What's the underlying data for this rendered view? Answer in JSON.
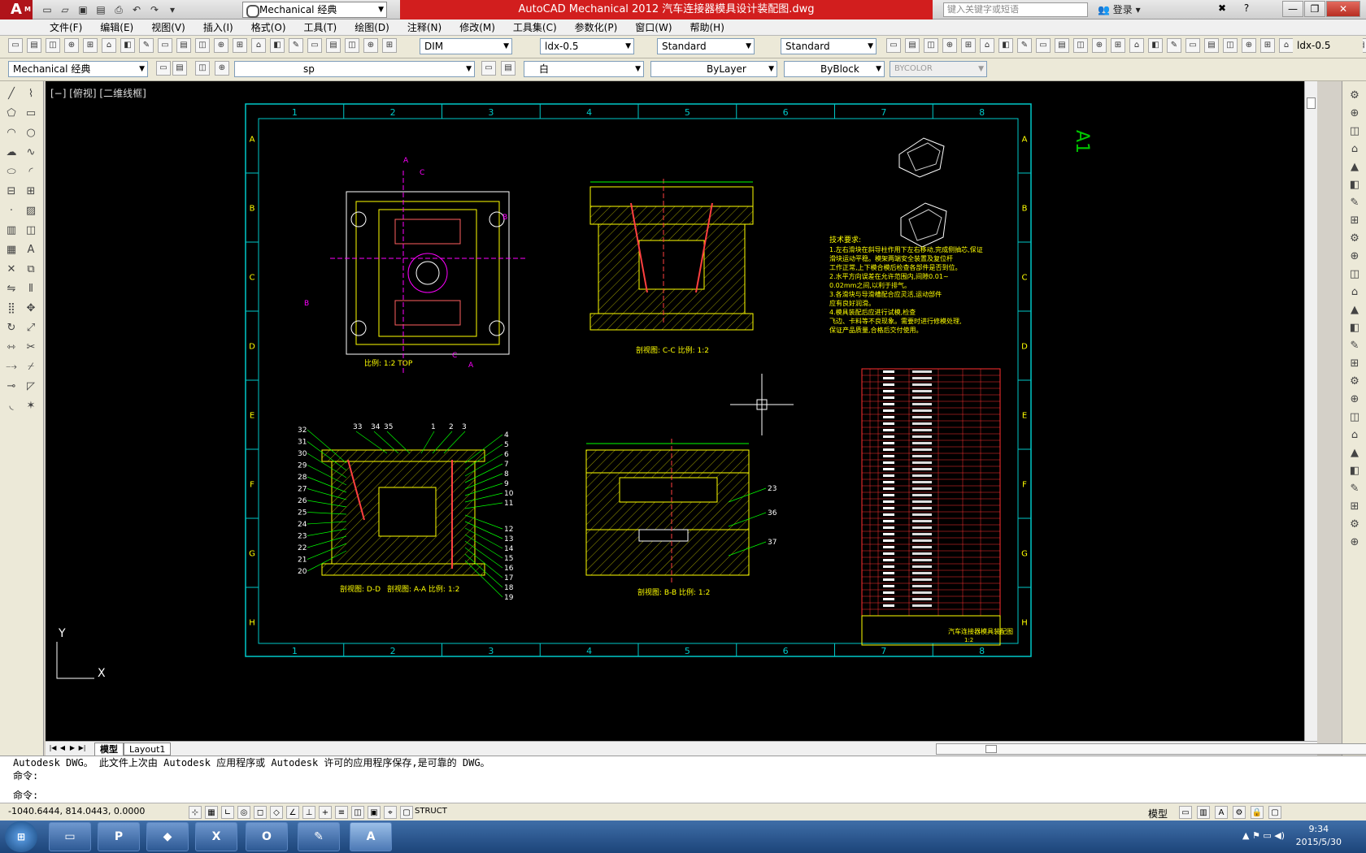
{
  "titlebar": {
    "app_logo": "A",
    "app_logo_sub": "M",
    "workspace": "Mechanical 经典",
    "title": "AutoCAD Mechanical 2012    汽车连接器模具设计装配图.dwg",
    "search_placeholder": "键入关键字或短语",
    "login": "登录"
  },
  "menu": [
    "文件(F)",
    "编辑(E)",
    "视图(V)",
    "插入(I)",
    "格式(O)",
    "工具(T)",
    "绘图(D)",
    "注释(N)",
    "修改(M)",
    "工具集(C)",
    "参数化(P)",
    "窗口(W)",
    "帮助(H)"
  ],
  "toolbar1": {
    "dim_style": "DIM",
    "text_height": "ldx-0.5",
    "text_style": "Standard",
    "table_style": "Standard",
    "mleader_style": "ldx-0.5"
  },
  "toolbar2": {
    "workspace": "Mechanical 经典",
    "layer": "sp",
    "color": "白",
    "linetype": "ByLayer",
    "lineweight": "ByBlock",
    "plotstyle": "BYCOLOR"
  },
  "viewport": {
    "label": "[−] [俯视] [二维线框]",
    "sheet_size": "A1",
    "ucs_x": "X",
    "ucs_y": "Y"
  },
  "drawing": {
    "col_labels": [
      "1",
      "2",
      "3",
      "4",
      "5",
      "6",
      "7",
      "8"
    ],
    "row_labels": [
      "A",
      "B",
      "C",
      "D",
      "E",
      "F",
      "G",
      "H"
    ],
    "views": {
      "top_caption": "比例: 1:2  TOP",
      "cc_caption": "剖视图: C-C  比例: 1:2",
      "aa_caption": "剖视图: A-A  比例: 1:2",
      "dd_caption": "剖视图: D-D",
      "bb_caption": "剖视图: B-B  比例: 1:2"
    },
    "section_marks": [
      "A",
      "C",
      "A",
      "C",
      "B",
      "B"
    ],
    "tech_title": "技术要求:",
    "tech_lines": [
      "1.左右滑块在斜导柱作用下左右移动,完成侧抽芯,保证",
      "滑块运动平稳。模架两端安全装置及复位杆",
      "工作正常,上下模合模后检查各部件是否到位。",
      "2.水平方向误差在允许范围内,间隙0.01~",
      "0.02mm之间,以利于排气。",
      "3.各滑块与导滑槽配合应灵活,运动部件",
      "应有良好润滑。",
      "4.模具装配后应进行试模,检查",
      "飞边、卡料等不良现象。需要时进行修模处理,",
      "保证产品质量,合格后交付使用。"
    ],
    "left_balloons": [
      "32",
      "31",
      "30",
      "29",
      "28",
      "27",
      "26",
      "25",
      "24",
      "23",
      "22",
      "21",
      "20"
    ],
    "top_balloons": [
      "33",
      "34",
      "35",
      "1",
      "2",
      "3"
    ],
    "right_balloons": [
      "4",
      "5",
      "6",
      "7",
      "8",
      "9",
      "10",
      "11",
      "12",
      "13",
      "14",
      "15",
      "16",
      "17",
      "18",
      "19"
    ],
    "bb_balloons": [
      "23",
      "36",
      "37"
    ],
    "title_block": "汽车连接器模具装配图",
    "title_block_sub": "1:2"
  },
  "layout_tabs": [
    "模型",
    "Layout1"
  ],
  "command": {
    "line1": "Autodesk DWG。  此文件上次由 Autodesk 应用程序或 Autodesk 许可的应用程序保存,是可靠的 DWG。",
    "line2": "命令:",
    "prompt": "命令:"
  },
  "status": {
    "coords": "-1040.6444, 814.0443, 0.0000",
    "struct": "STRUCT",
    "model": "模型"
  },
  "taskbar": {
    "time": "9:34",
    "date": "2015/5/30"
  }
}
